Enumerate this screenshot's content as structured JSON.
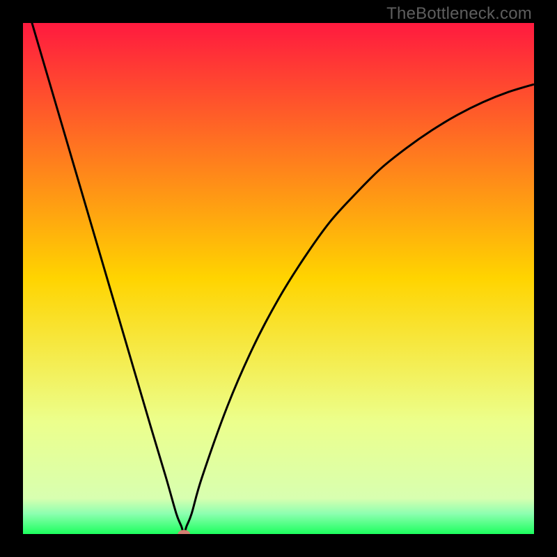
{
  "watermark": "TheBottleneck.com",
  "colors": {
    "frame": "#000000",
    "top": "#ff1a3f",
    "mid": "#ffd400",
    "low": "#ecff8c",
    "green": "#1cff5e",
    "curve": "#000000",
    "marker": "#d47f72"
  },
  "chart_data": {
    "type": "line",
    "title": "",
    "xlabel": "",
    "ylabel": "",
    "xlim": [
      0,
      100
    ],
    "ylim": [
      0,
      100
    ],
    "grid": false,
    "series": [
      {
        "name": "bottleneck-curve",
        "x": [
          0,
          5,
          10,
          15,
          20,
          25,
          28,
          30,
          31,
          31.5,
          32,
          33,
          35,
          40,
          45,
          50,
          55,
          60,
          65,
          70,
          75,
          80,
          85,
          90,
          95,
          100
        ],
        "values": [
          106,
          89,
          72,
          55,
          38,
          21,
          11,
          4,
          1.5,
          0,
          1.5,
          4,
          11,
          25,
          36.5,
          46,
          54,
          61,
          66.5,
          71.5,
          75.5,
          79,
          82,
          84.5,
          86.5,
          88
        ]
      }
    ],
    "marker": {
      "x": 31.5,
      "y": 0,
      "rx": 1.2,
      "ry": 0.8
    },
    "gradient_stops": [
      {
        "pct": 0,
        "color": "#ff1a3f"
      },
      {
        "pct": 50,
        "color": "#ffd400"
      },
      {
        "pct": 78,
        "color": "#ecff8c"
      },
      {
        "pct": 93,
        "color": "#d8ffb0"
      },
      {
        "pct": 96,
        "color": "#8dffb0"
      },
      {
        "pct": 100,
        "color": "#1cff5e"
      }
    ]
  }
}
